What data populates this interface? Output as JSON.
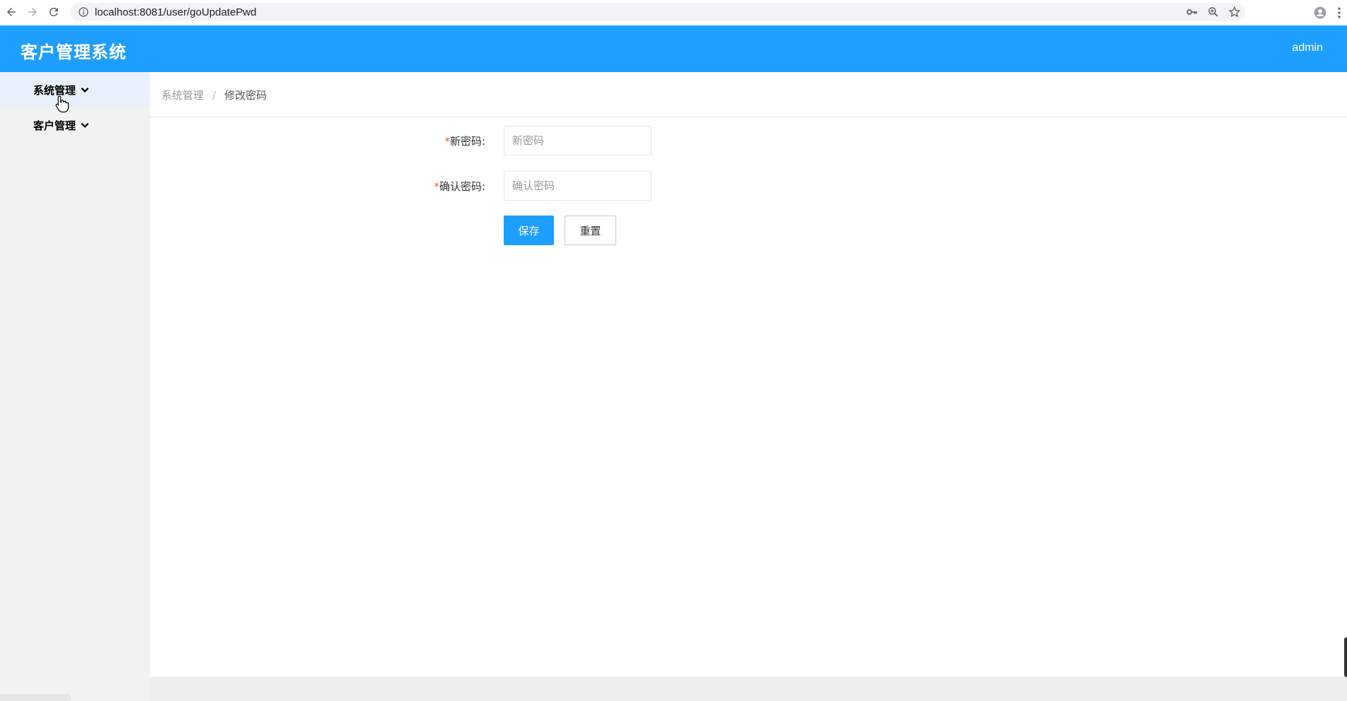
{
  "browser": {
    "url": "localhost:8081/user/goUpdatePwd"
  },
  "header": {
    "title": "客户管理系统",
    "user": "admin",
    "bg_color": "#1e9fff"
  },
  "sidebar": {
    "items": [
      {
        "label": "系统管理",
        "icon": "chevron-down-icon"
      },
      {
        "label": "客户管理",
        "icon": "chevron-down-icon"
      }
    ]
  },
  "breadcrumb": {
    "items": [
      "系统管理",
      "修改密码"
    ],
    "separator": "/"
  },
  "form": {
    "required_mark": "*",
    "new_password": {
      "label": "新密码:",
      "placeholder": "新密码",
      "value": ""
    },
    "confirm_password": {
      "label": "确认密码:",
      "placeholder": "确认密码",
      "value": ""
    },
    "save_label": "保存",
    "reset_label": "重置"
  },
  "colors": {
    "primary": "#1e9fff",
    "required": "#ff5722",
    "sidebar_bg": "#f2f2f2"
  }
}
